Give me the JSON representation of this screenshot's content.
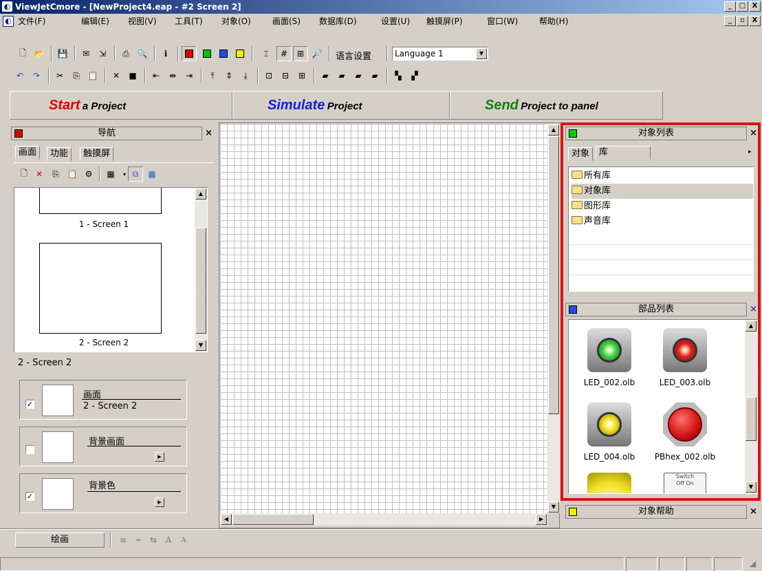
{
  "window": {
    "title": "ViewJetCmore - [NewProject4.eap - #2 Screen 2]",
    "min": "_",
    "max": "□",
    "close": "X",
    "child_min": "_",
    "child_restore": "▫",
    "child_close": "X"
  },
  "menu": [
    "文件(F)",
    "编辑(E)",
    "视图(V)",
    "工具(T)",
    "对象(O)",
    "画面(S)",
    "数据库(D)",
    "设置(U)",
    "触摸屏(P)",
    "窗口(W)",
    "帮助(H)"
  ],
  "toolbar": {
    "lang_label": "语言设置",
    "lang_value": "Language 1",
    "colors": [
      "#e00000",
      "#00c000",
      "#2050e0",
      "#f0f000"
    ]
  },
  "banner": {
    "start_big": "Start",
    "start_small": "a Project",
    "simulate_big": "Simulate",
    "simulate_small": "Project",
    "send_big": "Send",
    "send_small": "Project to panel",
    "start_color": "#e00000",
    "simulate_color": "#1a1ae0",
    "send_color": "#108010"
  },
  "nav": {
    "title": "导航",
    "tabs": [
      "画面",
      "功能",
      "触摸屏"
    ],
    "screens": [
      "1 - Screen 1",
      "2 - Screen 2"
    ],
    "current": "2 - Screen 2",
    "props": [
      {
        "label": "画面",
        "sub": "2 - Screen 2",
        "checked": "✓"
      },
      {
        "label": "背景画面",
        "sub": "",
        "checked": ""
      },
      {
        "label": "背景色",
        "sub": "",
        "checked": "✓"
      }
    ]
  },
  "object_list": {
    "title": "对象列表",
    "tabs": [
      "对象",
      "库"
    ],
    "libs": [
      "所有库",
      "对象库",
      "图形库",
      "声音库"
    ]
  },
  "parts": {
    "title": "部品列表",
    "items": [
      {
        "name": "LED_002.olb",
        "color": "#40d040"
      },
      {
        "name": "LED_003.olb",
        "color": "#e02020"
      },
      {
        "name": "LED_004.olb",
        "color": "#f0e020"
      },
      {
        "name": "PBhex_002.olb",
        "color": "#d01010"
      }
    ],
    "switch_label": "Switch",
    "switch_off": "Off",
    "switch_on": "On"
  },
  "object_help": {
    "title": "对象帮助"
  },
  "bottom": {
    "draw_label": "绘画"
  }
}
